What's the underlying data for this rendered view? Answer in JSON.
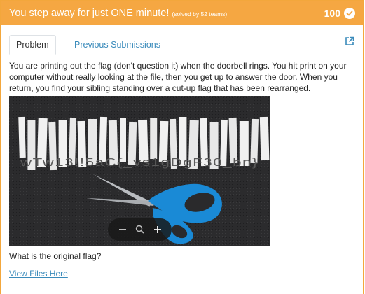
{
  "header": {
    "title": "You step away for just ONE minute!",
    "solved": "(solved by 52 teams)",
    "points": "100"
  },
  "tabs": [
    {
      "label": "Problem",
      "active": true
    },
    {
      "label": "Previous Submissions",
      "active": false
    }
  ],
  "description": "You are printing out the flag (don't question it) when the doorbell rings. You hit print on your computer without really looking at the file, then you get up to answer the door. When you return, you find your sibling standing over a cut-up flag that has been rearranged.",
  "image": {
    "strip_text": "wTw13!!5aC{_vs1gDgF30_bn}",
    "zoom_controls": [
      "zoom-out",
      "zoom-reset",
      "zoom-in"
    ]
  },
  "question": "What is the original flag?",
  "files_link": "View Files Here",
  "colors": {
    "accent": "#f5a742",
    "link": "#3a8bbb",
    "scissors_blue": "#1a8ad6"
  }
}
